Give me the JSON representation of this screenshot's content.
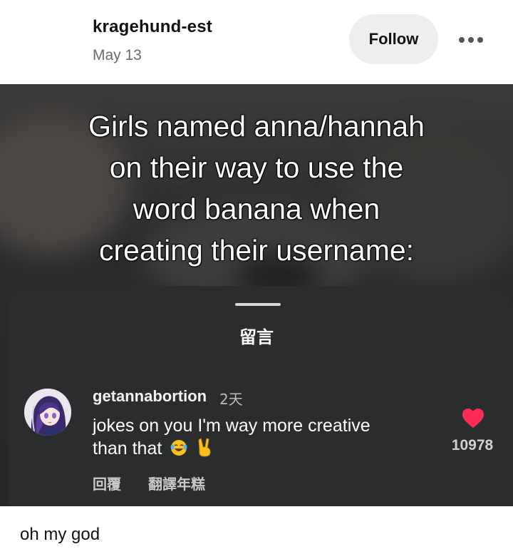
{
  "post": {
    "username": "kragehund-est",
    "date": "May 13",
    "follow_label": "Follow",
    "more_icon": "more-horizontal-icon",
    "caption": "oh my god"
  },
  "image": {
    "meme_lines": [
      "Girls named anna/hannah",
      "on their way to use the",
      "word banana when",
      "creating their username:"
    ],
    "sheet": {
      "title": "留言",
      "comment": {
        "user": "getannabortion",
        "time": "2天",
        "text_lines": [
          "jokes on you I'm way more creative",
          "than that"
        ],
        "emoji_icons": [
          "laughing-tears-emoji",
          "victory-hand-emoji"
        ],
        "reply_label": "回覆",
        "translate_label": "翻譯年糕",
        "like_count": "10978",
        "heart_color": "#fe2c55"
      }
    }
  }
}
